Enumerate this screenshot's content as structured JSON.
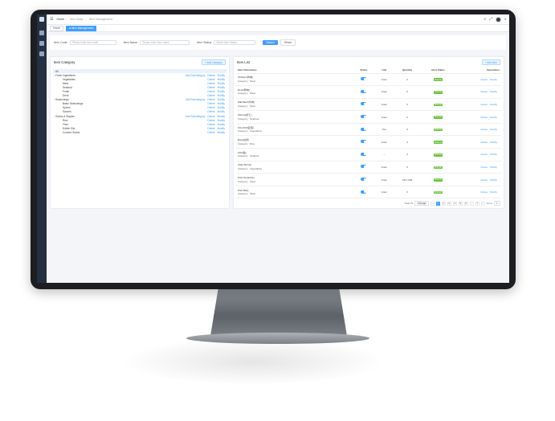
{
  "breadcrumb": {
    "home": "Home",
    "parent": "Item Basic",
    "current": "Item Management"
  },
  "tabs": [
    {
      "label": "Home"
    },
    {
      "label": "● Item Management"
    }
  ],
  "search": {
    "code_label": "Item Code",
    "code_placeholder": "Please enter item code",
    "name_label": "Item Name",
    "name_placeholder": "Please enter item name",
    "status_label": "Item Status",
    "status_placeholder": "Select item Status",
    "search_btn": "Search",
    "reset_btn": "Reset"
  },
  "category_panel": {
    "title": "Item Category",
    "add_btn": "+ Add Category",
    "ops": {
      "sub": "Add Subcategory",
      "del": "Delete",
      "mod": "Modify"
    },
    "tree": [
      {
        "label": "All",
        "level": 0,
        "sel": true,
        "ops": "none"
      },
      {
        "label": "Fresh Ingredients",
        "level": 0,
        "ops": "full"
      },
      {
        "label": "Vegetables",
        "level": 1,
        "ops": "dm"
      },
      {
        "label": "Meat",
        "level": 1,
        "ops": "dm"
      },
      {
        "label": "Seafood",
        "level": 1,
        "ops": "dm"
      },
      {
        "label": "Fruits",
        "level": 1,
        "ops": "dm"
      },
      {
        "label": "Drink",
        "level": 1,
        "ops": "dm"
      },
      {
        "label": "Seasonings",
        "level": 0,
        "ops": "full"
      },
      {
        "label": "Basic Seasonings",
        "level": 1,
        "ops": "dm"
      },
      {
        "label": "Spices",
        "level": 1,
        "ops": "dm"
      },
      {
        "label": "Sauces",
        "level": 1,
        "ops": "dm"
      },
      {
        "label": "Grains & Staples",
        "level": 0,
        "ops": "full"
      },
      {
        "label": "Rice",
        "level": 1,
        "ops": "dm"
      },
      {
        "label": "Flour",
        "level": 1,
        "ops": "dm"
      },
      {
        "label": "Edible Oils",
        "level": 1,
        "ops": "dm"
      },
      {
        "label": "Cooked Grains",
        "level": 1,
        "ops": "dm"
      }
    ]
  },
  "item_panel": {
    "title": "Item List",
    "add_btn": "+ Add Item",
    "headers": [
      "Item Information",
      "Status",
      "Unit",
      "Quantity",
      "Alert Status",
      "Operations"
    ],
    "ops": {
      "del": "Delete",
      "mod": "Modify"
    },
    "rows": [
      {
        "name": "Chicken(鸡肉)",
        "cat": "Category：Meat",
        "unit": "Gram",
        "qty": "0",
        "alert": "Normal"
      },
      {
        "name": "Duck(鸭肉)",
        "cat": "Category：Meat",
        "unit": "Gram",
        "qty": "0",
        "alert": "Normal"
      },
      {
        "name": "Wild Beef(牛肉)",
        "cat": "Category：Meat",
        "unit": "Gram",
        "qty": "0",
        "alert": "Normal"
      },
      {
        "name": "Shrimp(虾仁)",
        "cat": "Category：Seafood",
        "unit": "Gram",
        "qty": "0",
        "alert": "Normal"
      },
      {
        "name": "Tofu Puff(豆泡)",
        "cat": "Category：Vegetables",
        "unit": "Pcs",
        "qty": "0",
        "alert": "Normal"
      },
      {
        "name": "Rice(白米)",
        "cat": "Category：Rice",
        "unit": "Gram",
        "qty": "0",
        "alert": "Normal"
      },
      {
        "name": "Fish(鱼)",
        "cat": "Category：Seafood",
        "unit": "--",
        "qty": "0",
        "alert": "Normal"
      },
      {
        "name": "Claw Shrimp",
        "cat": "Category：Vegetables",
        "unit": "Gram",
        "qty": "0",
        "alert": "Normal"
      },
      {
        "name": "Pork Tenderloin",
        "cat": "Category：Meat",
        "unit": "Gram",
        "qty": "4117.068",
        "alert": "Normal"
      },
      {
        "name": "Pork Belly",
        "cat": "Category：Meat",
        "unit": "Gram",
        "qty": "0",
        "alert": "Normal"
      }
    ]
  },
  "pager": {
    "total": "Total 70",
    "size": "10/page",
    "pages": [
      "‹",
      "1",
      "2",
      "3",
      "4",
      "5",
      "6",
      "...",
      "7",
      "›"
    ],
    "active": "1",
    "goto": "Go to",
    "goto_val": "1"
  },
  "colors": {
    "accent": "#409eff",
    "normal": "#67c23a",
    "sidebar": "#243042"
  }
}
